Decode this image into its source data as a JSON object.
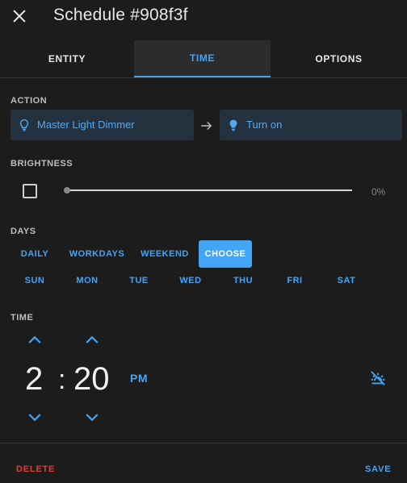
{
  "header": {
    "title": "Schedule #908f3f",
    "close_icon": "close-icon"
  },
  "tabs": [
    {
      "label": "ENTITY",
      "active": false
    },
    {
      "label": "TIME",
      "active": true
    },
    {
      "label": "OPTIONS",
      "active": false
    }
  ],
  "action": {
    "label": "ACTION",
    "entity": {
      "name": "Master Light Dimmer",
      "icon": "lightbulb-outline-icon"
    },
    "arrow_icon": "arrow-right-icon",
    "service": {
      "name": "Turn on",
      "icon": "lightbulb-icon"
    }
  },
  "brightness": {
    "label": "BRIGHTNESS",
    "enabled": false,
    "value_label": "0%",
    "value": 0
  },
  "days": {
    "label": "DAYS",
    "modes": [
      "DAILY",
      "WORKDAYS",
      "WEEKEND",
      "CHOOSE"
    ],
    "selected_mode": "CHOOSE",
    "weekdays": [
      "SUN",
      "MON",
      "TUE",
      "WED",
      "THU",
      "FRI",
      "SAT"
    ]
  },
  "time": {
    "label": "TIME",
    "hours": "2",
    "separator": ":",
    "minutes": "20",
    "period": "PM",
    "sun_mode_icon": "weather-sunset-off-icon"
  },
  "footer": {
    "delete_label": "DELETE",
    "save_label": "SAVE"
  },
  "colors": {
    "accent": "#42a5f5",
    "danger": "#d9403a",
    "background": "#1c1c1c"
  }
}
